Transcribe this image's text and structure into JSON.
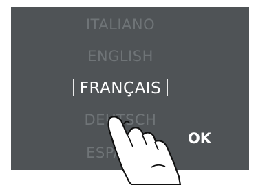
{
  "language_selector": {
    "options": [
      {
        "label": "ITALIANO",
        "selected": false
      },
      {
        "label": "ENGLISH",
        "selected": false
      },
      {
        "label": "FRANÇAIS",
        "selected": true
      },
      {
        "label": "DEUTSCH",
        "selected": false
      },
      {
        "label": "ESPAÑOL",
        "selected": false
      }
    ]
  },
  "ok_button": {
    "label": "OK"
  },
  "colors": {
    "panel": "#4f5356",
    "selected_text": "#ffffff",
    "unselected_text": "#6f7477"
  },
  "icons": {
    "pointer": "hand-pointer-icon"
  }
}
